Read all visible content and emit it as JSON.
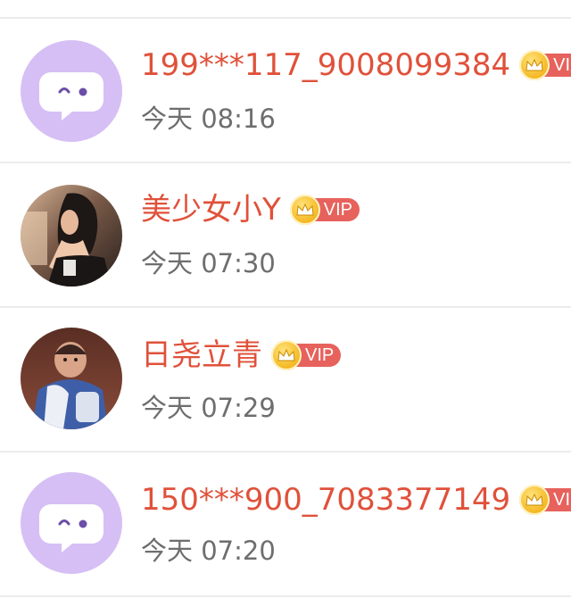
{
  "contacts": [
    {
      "name": "199***117_9008099384",
      "time": "今天 08:16",
      "avatar_icon": "chat-bubble-icon",
      "vip": "VIP"
    },
    {
      "name": "美少女小Y",
      "time": "今天 07:30",
      "avatar_icon": "photo-avatar-woman",
      "vip": "VIP"
    },
    {
      "name": "日尧立青",
      "time": "今天 07:29",
      "avatar_icon": "photo-avatar-baby",
      "vip": "VIP"
    },
    {
      "name": "150***900_7083377149",
      "time": "今天 07:20",
      "avatar_icon": "chat-bubble-icon",
      "vip": "VIP"
    }
  ],
  "colors": {
    "name": "#e0513a",
    "time": "#6e6e6e",
    "default_avatar_bg": "#d6bff5",
    "vip_badge": "#e7625c",
    "crown": "#f4b51c",
    "divider": "#ececec"
  }
}
